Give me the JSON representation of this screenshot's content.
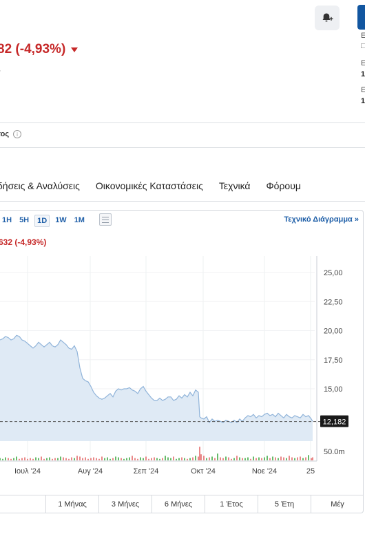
{
  "header": {
    "price_change": "82 (-4,93%)",
    "small_text": "·",
    "side_info": [
      {
        "text": "E",
        "bold": false
      },
      {
        "text": "□",
        "bold": false
      },
      {
        "text": "E",
        "bold": false
      },
      {
        "text": "1",
        "bold": true
      },
      {
        "text": "E",
        "bold": false
      },
      {
        "text": "1",
        "bold": true
      }
    ]
  },
  "period_label": "τος",
  "tabs": [
    "δήσεις & Αναλύσεις",
    "Οικονομικές Καταστάσεις",
    "Τεχνικά",
    "Φόρουμ"
  ],
  "chart_toolbar": {
    "ranges": [
      "1H",
      "5H",
      "1D",
      "1W",
      "1M"
    ],
    "active_range": "1D",
    "tech_link": "Τεχνικό Διάγραμμα »"
  },
  "chart_price_label": "632 (-4,93%)",
  "bottom_periods": [
    "",
    "1 Μήνας",
    "3 Μήνες",
    "6 Μήνες",
    "1 Έτος",
    "5 Έτη",
    "Μέγ"
  ],
  "colors": {
    "negative": "#c62828",
    "link": "#1f5fa8",
    "area_fill": "#dfeaf5",
    "line": "#8fb3d9",
    "vol_up": "#4caf50",
    "vol_down": "#e57373"
  },
  "chart_data": {
    "type": "area",
    "title": "",
    "xlabel": "",
    "ylabel": "",
    "ylim": [
      12.182,
      25
    ],
    "y_ticks": [
      "25,00",
      "22,50",
      "20,00",
      "17,50",
      "15,00"
    ],
    "y_tick_values": [
      25,
      22.5,
      20,
      17.5,
      15
    ],
    "x_ticks": [
      "Ιουλ '24",
      "Αυγ '24",
      "Σεπ '24",
      "Οκτ '24",
      "Νοε '24",
      "25"
    ],
    "last_value": 12.182,
    "last_value_label": "12,182",
    "volume_label": "50.0m",
    "series": [
      {
        "x": [
          0,
          4,
          8,
          12,
          16,
          20,
          24,
          28,
          32,
          36,
          40,
          44,
          48,
          52,
          56,
          60,
          64,
          68,
          72,
          76,
          80,
          84,
          88,
          92,
          96,
          100,
          104,
          108,
          112,
          116,
          120,
          124,
          128,
          132,
          136,
          140,
          144,
          148,
          152,
          156,
          160,
          164,
          168,
          172,
          176,
          180,
          184,
          188,
          192,
          196,
          200,
          204,
          208,
          212,
          216,
          220,
          224,
          228,
          232,
          236,
          240,
          244,
          248,
          252,
          256,
          260,
          264,
          268,
          272,
          276,
          280,
          284,
          288,
          290,
          292,
          296,
          300,
          304,
          308,
          312,
          316,
          320,
          324,
          328,
          332,
          336,
          340,
          344,
          348,
          352,
          356,
          360,
          364,
          368,
          372,
          376,
          380,
          384,
          388,
          392,
          396,
          400,
          404,
          408,
          412,
          416,
          420,
          424,
          428,
          432,
          436,
          440,
          444,
          448,
          452,
          454
        ],
        "values": [
          19.2,
          19.3,
          19.5,
          19.4,
          19.2,
          19.3,
          19.6,
          19.5,
          19.2,
          19.1,
          18.9,
          18.7,
          18.5,
          18.7,
          19.0,
          18.8,
          18.6,
          18.8,
          19.0,
          18.7,
          18.6,
          18.8,
          19.2,
          19.0,
          18.8,
          18.5,
          18.4,
          18.7,
          18.2,
          16.8,
          15.9,
          15.7,
          15.6,
          15.2,
          14.7,
          14.4,
          14.2,
          14.1,
          14.2,
          14.4,
          14.6,
          14.3,
          14.8,
          15.0,
          14.9,
          15.0,
          15.0,
          15.1,
          14.9,
          14.8,
          14.6,
          15.0,
          15.2,
          14.8,
          14.5,
          14.2,
          14.0,
          14.0,
          14.2,
          14.0,
          14.1,
          14.3,
          14.3,
          14.0,
          14.1,
          14.4,
          14.2,
          14.5,
          14.3,
          14.7,
          14.4,
          14.9,
          14.7,
          12.6,
          12.5,
          12.4,
          12.6,
          12.1,
          12.4,
          12.2,
          12.3,
          12.2,
          12.1,
          12.3,
          12.2,
          12.1,
          12.3,
          12.1,
          12.4,
          12.2,
          12.5,
          12.7,
          12.6,
          12.8,
          12.5,
          12.7,
          12.6,
          12.8,
          12.9,
          12.7,
          12.8,
          12.6,
          12.9,
          12.7,
          12.5,
          12.8,
          12.6,
          12.5,
          12.7,
          12.6,
          12.5,
          12.8,
          12.6,
          12.7,
          12.4,
          12.2
        ]
      }
    ],
    "volume": [
      3,
      2,
      4,
      3,
      2,
      3,
      5,
      2,
      3,
      4,
      2,
      3,
      2,
      4,
      3,
      5,
      2,
      3,
      4,
      2,
      3,
      3,
      5,
      4,
      3,
      2,
      4,
      3,
      6,
      5,
      3,
      4,
      2,
      3,
      4,
      3,
      2,
      5,
      3,
      4,
      2,
      3,
      5,
      4,
      3,
      2,
      3,
      4,
      6,
      3,
      2,
      4,
      3,
      5,
      2,
      3,
      4,
      3,
      2,
      3,
      6,
      4,
      3,
      5,
      2,
      3,
      4,
      3,
      2,
      3,
      4,
      6,
      5,
      18,
      8,
      6,
      3,
      4,
      5,
      3,
      9,
      4,
      3,
      5,
      4,
      2,
      3,
      6,
      4,
      3,
      3,
      4,
      2,
      5,
      3,
      4,
      3,
      4,
      6,
      3,
      5,
      4,
      3,
      5,
      4,
      3,
      6,
      4,
      3,
      4,
      5,
      3,
      4,
      7,
      3,
      4
    ]
  }
}
